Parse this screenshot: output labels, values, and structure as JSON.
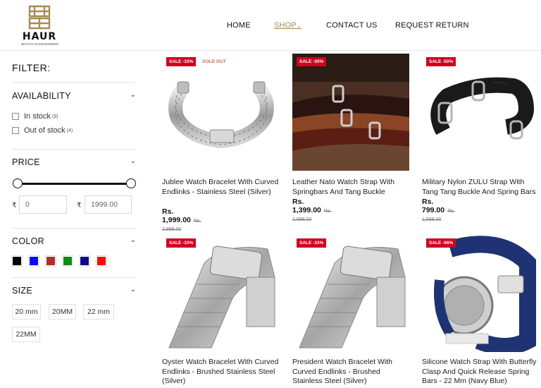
{
  "brand": {
    "name": "HAUR",
    "tagline": "WATCH ACCESSORIES",
    "gold": "#a78a55"
  },
  "nav": [
    {
      "label": "HOME"
    },
    {
      "label": "SHOP",
      "active": true,
      "chevron": "⌄"
    },
    {
      "label": "CONTACT US"
    },
    {
      "label": "REQUEST RETURN"
    }
  ],
  "filter": {
    "title": "FILTER:",
    "availability": {
      "title": "AVAILABILITY",
      "options": [
        {
          "label": "In stock",
          "count": "(9)"
        },
        {
          "label": "Out of stock",
          "count": "(4)"
        }
      ]
    },
    "price": {
      "title": "PRICE",
      "currency": "₹",
      "min": "0",
      "max": "1999.00"
    },
    "color": {
      "title": "COLOR",
      "swatches": [
        "#000000",
        "#0a0aff",
        "#a83232",
        "#118a11",
        "#0c0c8a",
        "#ff0a0a"
      ]
    },
    "size": {
      "title": "SIZE",
      "options": [
        "20 mm",
        "20MM",
        "22 mm",
        "22MM"
      ]
    },
    "chevron": "⌄"
  },
  "products": [
    {
      "badge": "SALE -33%",
      "soldout": "SOLD OUT",
      "name": "Jublee Watch Bracelet With Curved Endlinks - Stainless Steel (Silver)",
      "price": "Rs. 1,999.00",
      "old": "Rs. 2,999.00"
    },
    {
      "badge": "SALE -30%",
      "name": "Leather Nato Watch Strap With Springbars And Tang Buckle",
      "price": "Rs. 1,399.00",
      "old": "Rs. 1,999.00"
    },
    {
      "badge": "SALE -50%",
      "name": "Military Nylon ZULU Strap With Tang Tang Buckle And Spring Bars",
      "price": "Rs. 799.00",
      "old": "Rs. 1,599.00"
    },
    {
      "badge": "SALE -33%",
      "name": "Oyster Watch Bracelet With Curved Endlinks - Brushed Stainless Steel (Silver)"
    },
    {
      "badge": "SALE -33%",
      "name": "President Watch Bracelet With Curved Endlinks - Brushed Stainless Steel (Silver)"
    },
    {
      "badge": "SALE -66%",
      "name": "Silicone Watch Strap With Butterfly Clasp And Quick Release Spring Bars - 22 Mm (Navy Blue)"
    }
  ]
}
